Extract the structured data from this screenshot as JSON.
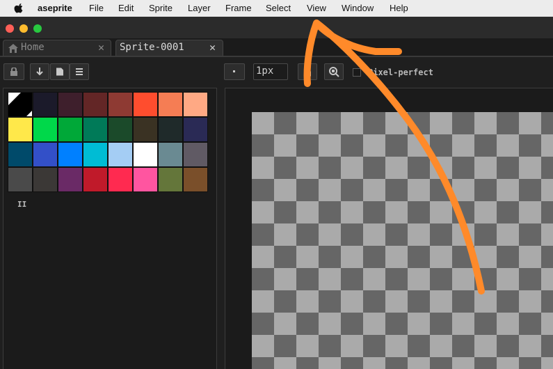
{
  "menubar": {
    "app_name": "aseprite",
    "items": [
      "File",
      "Edit",
      "Sprite",
      "Layer",
      "Frame",
      "Select",
      "View",
      "Window",
      "Help"
    ]
  },
  "tabs": [
    {
      "label": "Home",
      "active": false
    },
    {
      "label": "Sprite-0001",
      "active": true
    }
  ],
  "tab_close_glyph": "✕",
  "toolbar": {
    "brush_size": "1px",
    "pixel_perfect_label": "Pixel-perfect",
    "pixel_perfect_checked": false
  },
  "palette": {
    "colors": [
      "#000000",
      "#1b1a2a",
      "#3e1f2c",
      "#632626",
      "#8e3a33",
      "#ff4d2e",
      "#f57d54",
      "#ffa984",
      "#ffe84a",
      "#00d84a",
      "#00a838",
      "#007a58",
      "#1b4a2a",
      "#3a3223",
      "#1f2a2a",
      "#2a2a55",
      "#004a6a",
      "#3350c8",
      "#0080ff",
      "#00bcd4",
      "#a4cdf4",
      "#ffffff",
      "#6a8a92",
      "#605a64",
      "#4a4a4a",
      "#3b3836",
      "#6a2a66",
      "#c01a2a",
      "#ff2a50",
      "#ff55a0",
      "#64763a",
      "#7a4f2a"
    ],
    "menu_glyph": "II"
  },
  "annotation_color": "#ff8a2a"
}
